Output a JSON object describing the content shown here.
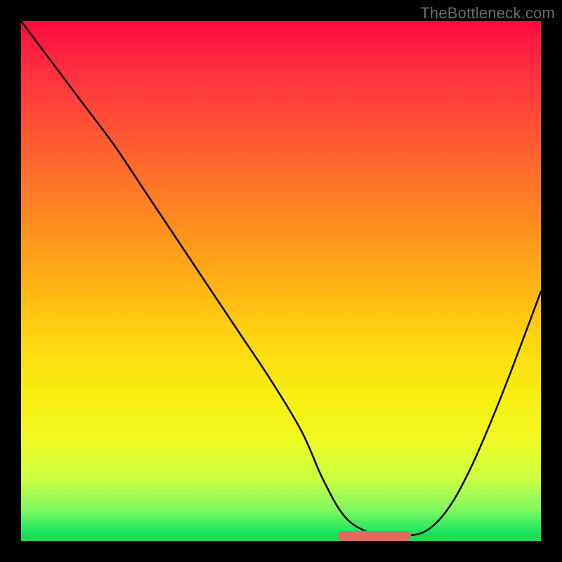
{
  "watermark": "TheBottleneck.com",
  "chart_data": {
    "type": "line",
    "title": "",
    "xlabel": "",
    "ylabel": "",
    "xlim": [
      0,
      100
    ],
    "ylim": [
      0,
      100
    ],
    "grid": false,
    "legend": false,
    "series": [
      {
        "name": "bottleneck-curve",
        "x": [
          0,
          6,
          12,
          18,
          24,
          30,
          36,
          42,
          48,
          54,
          58,
          62,
          66,
          70,
          74,
          78,
          82,
          86,
          90,
          94,
          100
        ],
        "y": [
          100,
          92,
          84,
          76,
          67,
          58,
          49,
          40,
          31,
          21,
          12,
          5,
          2,
          1,
          1,
          2,
          6,
          13,
          22,
          32,
          48
        ]
      }
    ],
    "annotations": [
      {
        "name": "optimal-range",
        "x_start": 61,
        "x_end": 75,
        "y": 1
      }
    ],
    "background_gradient": {
      "direction": "vertical",
      "stops": [
        {
          "pos": 0.0,
          "color": "#ff0b3f"
        },
        {
          "pos": 0.25,
          "color": "#ff6030"
        },
        {
          "pos": 0.5,
          "color": "#ffb015"
        },
        {
          "pos": 0.72,
          "color": "#f8ef10"
        },
        {
          "pos": 0.94,
          "color": "#80f860"
        },
        {
          "pos": 1.0,
          "color": "#00d860"
        }
      ]
    }
  }
}
